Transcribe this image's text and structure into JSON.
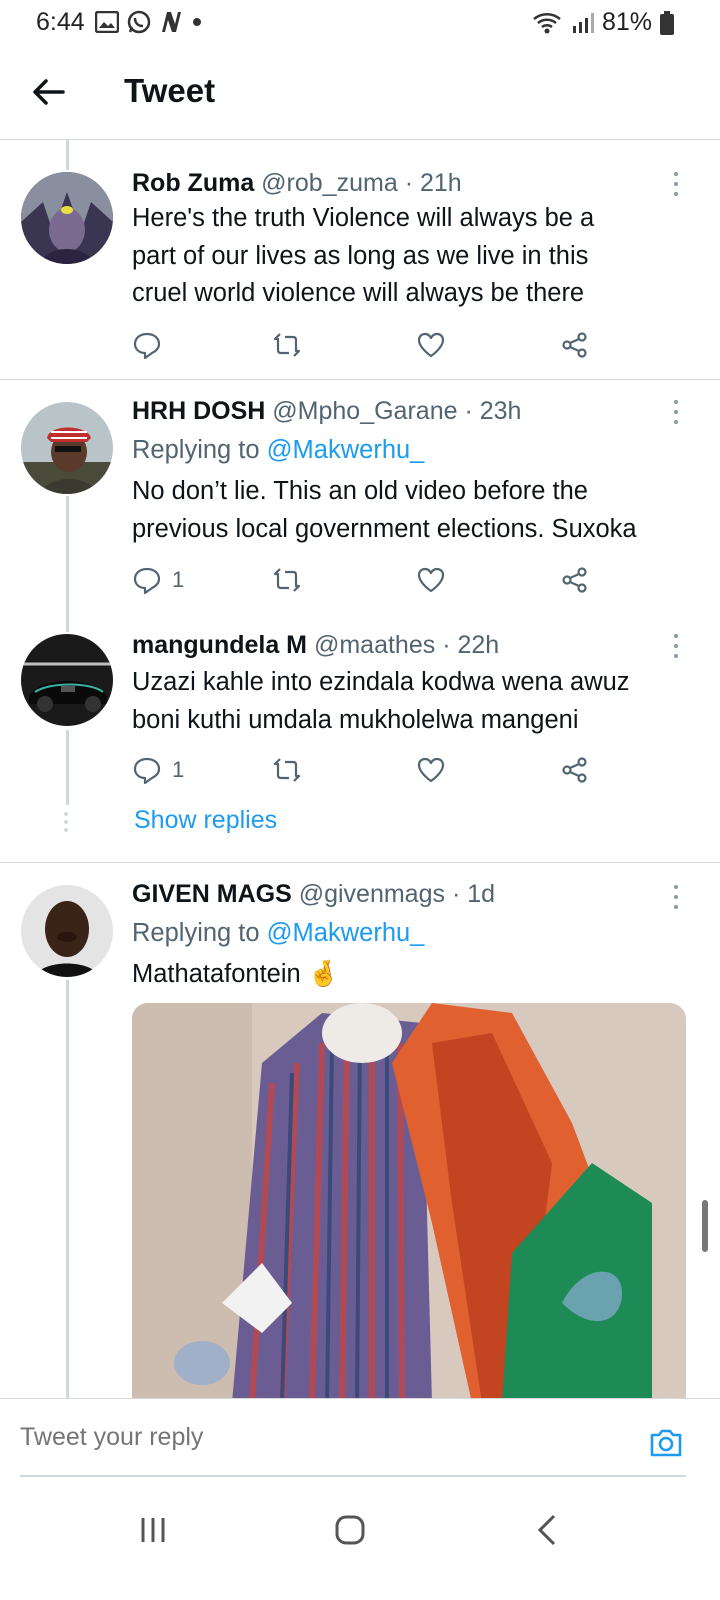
{
  "status_bar": {
    "time": "6:44",
    "battery": "81%"
  },
  "header": {
    "title": "Tweet"
  },
  "tweets": [
    {
      "name": "Rob Zuma",
      "handle": "@rob_zuma",
      "time": "· 21h",
      "text_lines": [
        "Here's the truth Violence will always be a",
        "part of our lives as long as we live in this",
        "cruel world violence will always be there"
      ],
      "reply_count": ""
    },
    {
      "name": "HRH DOSH",
      "handle": "@Mpho_Garane",
      "time": "· 23h",
      "replying_prefix": "Replying to ",
      "replying_to": "@Makwerhu_",
      "text_lines": [
        "No don’t lie. This an old video before the",
        "previous local government elections. Suxoka"
      ],
      "reply_count": "1"
    },
    {
      "name": "mangundela M",
      "handle": "@maathes",
      "time": "· 22h",
      "text_lines": [
        "Uzazi kahle into ezindala kodwa wena awuz",
        "boni kuthi umdala mukholelwa mangeni"
      ],
      "reply_count": "1",
      "show_replies": "Show replies"
    },
    {
      "name": "GIVEN MAGS",
      "handle": "@givenmags",
      "time": "· 1d",
      "replying_prefix": "Replying to ",
      "replying_to": "@Makwerhu_",
      "text": "Mathatafontein",
      "emoji": "🤞"
    }
  ],
  "reply_bar": {
    "placeholder": "Tweet your reply"
  },
  "icons": {
    "status": [
      "gallery-icon",
      "whatsapp-icon",
      "n-app-icon",
      "notification-dot-icon",
      "wifi-icon",
      "signal-icon",
      "battery-icon"
    ],
    "actions": [
      "reply-icon",
      "retweet-icon",
      "like-icon",
      "share-icon"
    ],
    "nav": [
      "recent-apps-icon",
      "home-icon",
      "back-icon"
    ]
  },
  "colors": {
    "accent": "#1d9bf0",
    "secondary_text": "#536471",
    "thread_line": "#cfd9de"
  }
}
